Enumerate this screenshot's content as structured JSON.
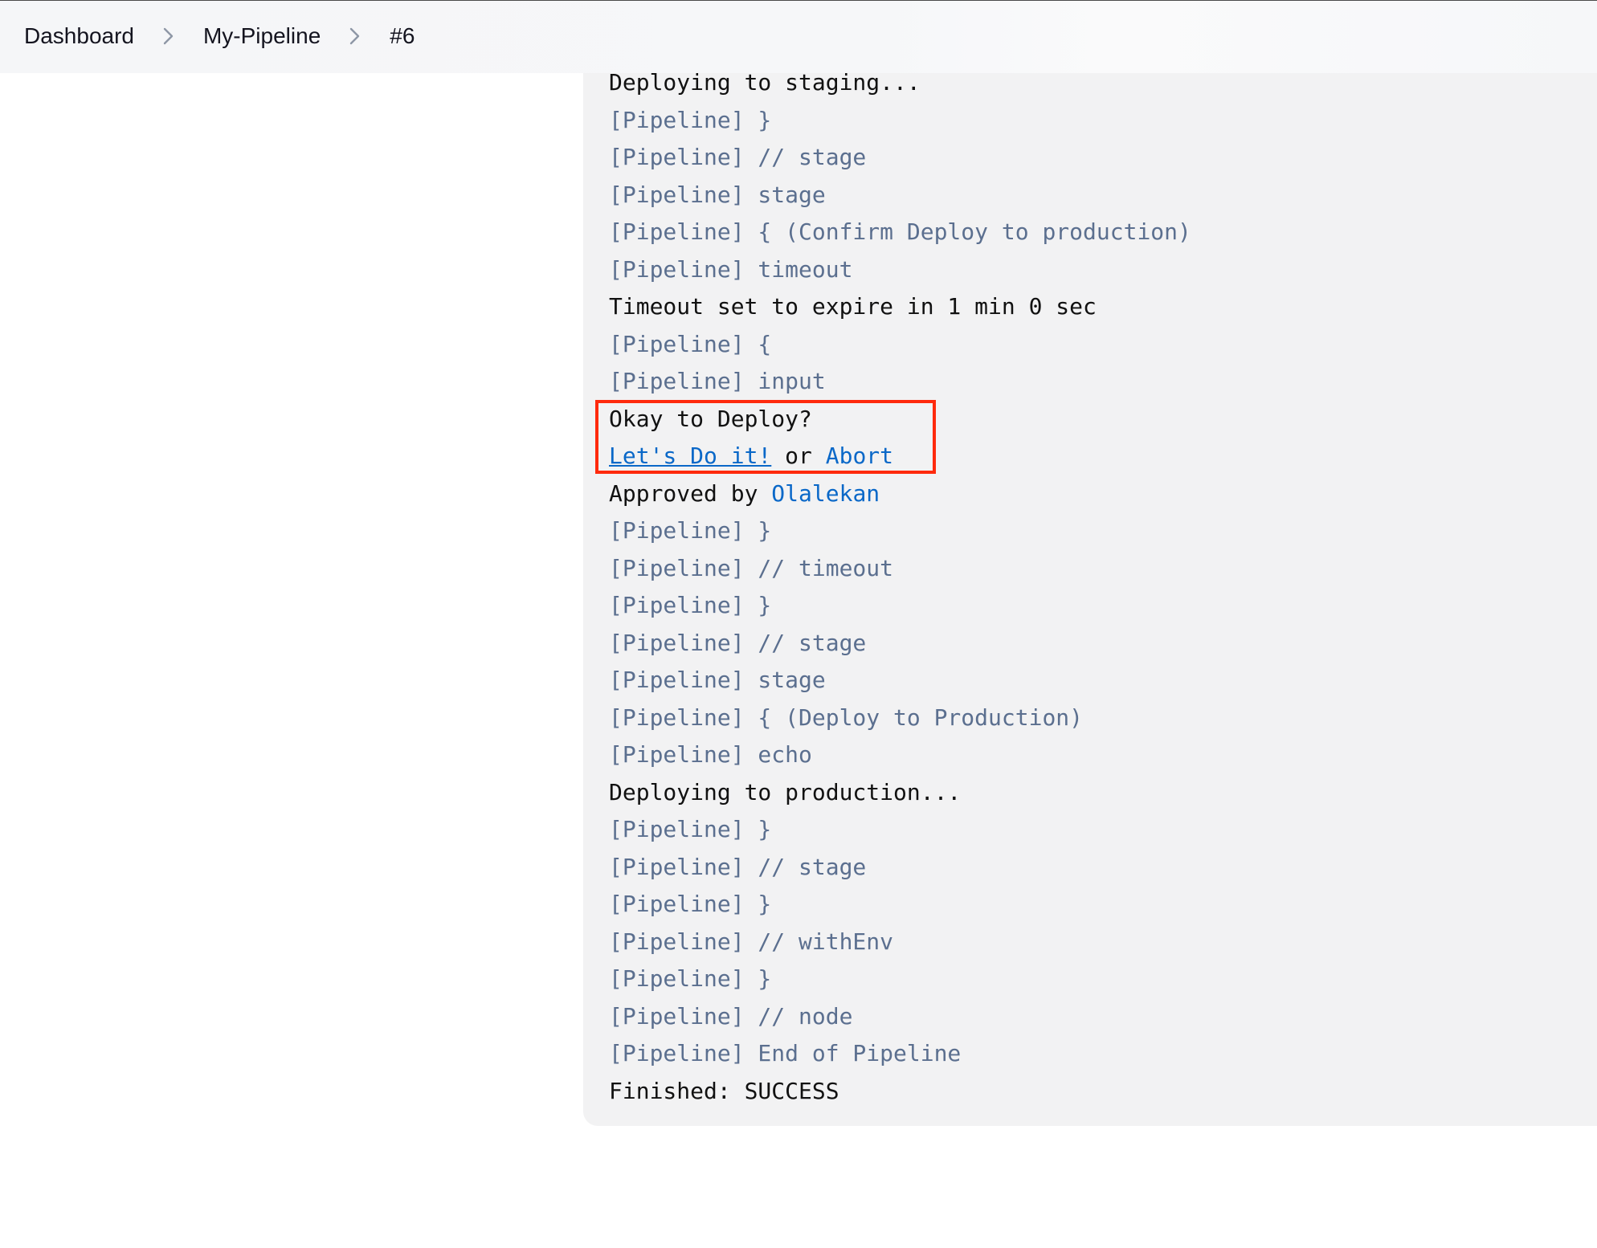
{
  "breadcrumb": {
    "items": [
      "Dashboard",
      "My-Pipeline",
      "#6"
    ]
  },
  "console": {
    "partial_first_line": "Deploying to staging...",
    "lines": [
      {
        "text": "[Pipeline] }",
        "kind": "pipeline"
      },
      {
        "text": "[Pipeline] // stage",
        "kind": "pipeline"
      },
      {
        "text": "[Pipeline] stage",
        "kind": "pipeline"
      },
      {
        "text": "[Pipeline] { (Confirm Deploy to production)",
        "kind": "pipeline"
      },
      {
        "text": "[Pipeline] timeout",
        "kind": "pipeline"
      },
      {
        "text": "Timeout set to expire in 1 min 0 sec",
        "kind": "output"
      },
      {
        "text": "[Pipeline] {",
        "kind": "pipeline"
      },
      {
        "text": "[Pipeline] input",
        "kind": "pipeline"
      },
      {
        "text": "Okay to Deploy?",
        "kind": "output"
      }
    ],
    "input_prompt": {
      "proceed_label": "Let's Do it!",
      "or_text": " or ",
      "abort_label": "Abort"
    },
    "approved": {
      "prefix": "Approved by ",
      "user": "Olalekan"
    },
    "lines_after": [
      {
        "text": "[Pipeline] }",
        "kind": "pipeline"
      },
      {
        "text": "[Pipeline] // timeout",
        "kind": "pipeline"
      },
      {
        "text": "[Pipeline] }",
        "kind": "pipeline"
      },
      {
        "text": "[Pipeline] // stage",
        "kind": "pipeline"
      },
      {
        "text": "[Pipeline] stage",
        "kind": "pipeline"
      },
      {
        "text": "[Pipeline] { (Deploy to Production)",
        "kind": "pipeline"
      },
      {
        "text": "[Pipeline] echo",
        "kind": "pipeline"
      },
      {
        "text": "Deploying to production...",
        "kind": "output"
      },
      {
        "text": "[Pipeline] }",
        "kind": "pipeline"
      },
      {
        "text": "[Pipeline] // stage",
        "kind": "pipeline"
      },
      {
        "text": "[Pipeline] }",
        "kind": "pipeline"
      },
      {
        "text": "[Pipeline] // withEnv",
        "kind": "pipeline"
      },
      {
        "text": "[Pipeline] }",
        "kind": "pipeline"
      },
      {
        "text": "[Pipeline] // node",
        "kind": "pipeline"
      },
      {
        "text": "[Pipeline] End of Pipeline",
        "kind": "pipeline"
      },
      {
        "text": "Finished: SUCCESS",
        "kind": "output"
      }
    ]
  },
  "colors": {
    "pipeline_text": "#5b6f8f",
    "output_text": "#111111",
    "link": "#0a68c8",
    "highlight": "#ff2a0d",
    "console_bg": "#f2f2f3"
  },
  "icons": {
    "breadcrumb_separator": "chevron-right-icon"
  }
}
